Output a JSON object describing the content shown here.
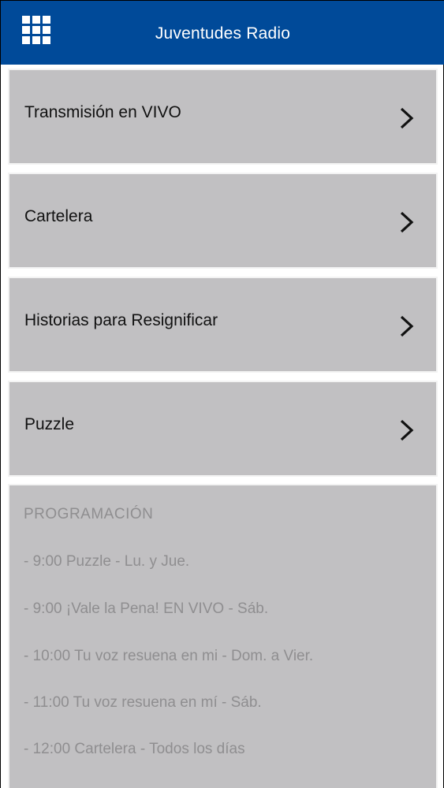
{
  "header": {
    "title": "Juventudes Radio",
    "menu_icon": "grid-icon"
  },
  "menu": {
    "items": [
      {
        "label": "Transmisión en VIVO",
        "icon": "chevron-right-icon"
      },
      {
        "label": "Cartelera",
        "icon": "chevron-right-icon"
      },
      {
        "label": "Historias para Resignificar",
        "icon": "chevron-right-icon"
      },
      {
        "label": "Puzzle",
        "icon": "chevron-right-icon"
      }
    ]
  },
  "programming": {
    "heading": "PROGRAMACIÓN",
    "lines": [
      "- 9:00 Puzzle - Lu. y Jue.",
      "- 9:00 ¡Vale la Pena! EN VIVO - Sáb.",
      "- 10:00 Tu voz resuena en mi - Dom. a Vier.",
      "- 11:00 Tu voz resuena en mí - Sáb.",
      "- 12:00 Cartelera - Todos los días"
    ]
  },
  "colors": {
    "header_bg": "#004a99",
    "card_bg": "#c1c0c2",
    "muted_text": "#8f8e90"
  }
}
